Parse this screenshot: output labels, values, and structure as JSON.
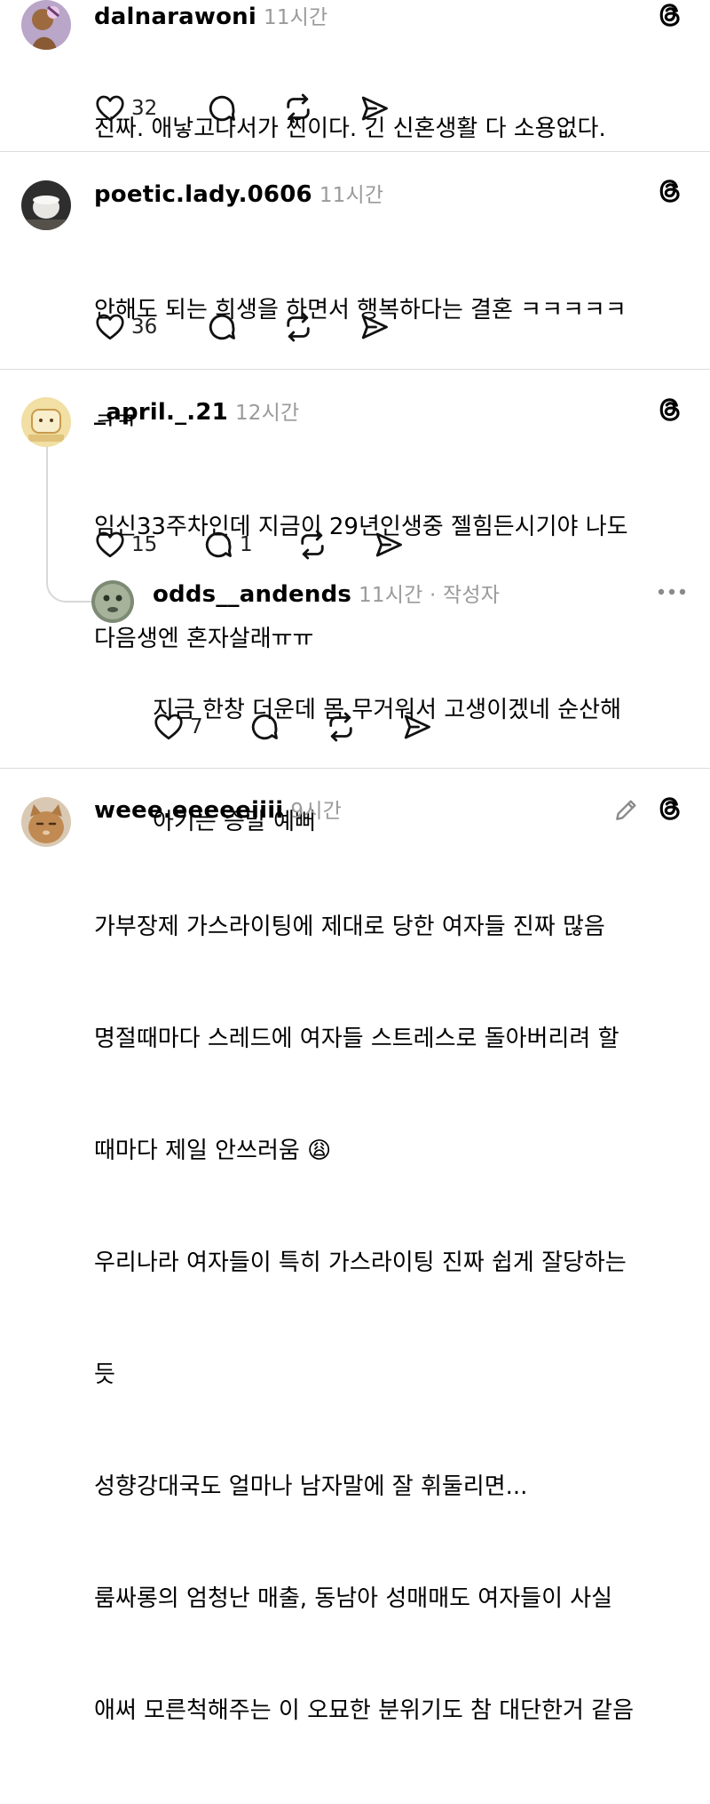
{
  "posts": [
    {
      "username": "dalnarawoni",
      "time": "11시간",
      "lines": [
        "진짜. 애낳고나서가 찐이다. 긴 신혼생활 다 소용없다."
      ],
      "likes": "32",
      "replies": ""
    },
    {
      "username": "poetic.lady.0606",
      "time": "11시간",
      "lines": [
        "안해도 되는 희생을 하면서 행복하다는 결혼 ㅋㅋㅋㅋㅋ",
        "ㅋㅋ"
      ],
      "likes": "36",
      "replies": ""
    },
    {
      "username": "_april._.21",
      "time": "12시간",
      "lines": [
        "임신33주차인데 지금이 29년인생중 젤힘든시기야 나도",
        "다음생엔 혼자살래ㅠㅠ"
      ],
      "likes": "15",
      "replies": "1"
    },
    {
      "username": "odds__andends",
      "time": "11시간",
      "author_tag": " · 작성자",
      "lines": [
        "지금 한창 더운데 몸 무거워서 고생이겠네 순산해",
        "아기는 증말 예뻐"
      ],
      "likes": "7",
      "replies": ""
    },
    {
      "username": "weee.eeeeeiiii",
      "time": "9시간",
      "lines": [
        "가부장제 가스라이팅에 제대로 당한 여자들 진짜 많음",
        "명절때마다 스레드에 여자들 스트레스로 돌아버리려 할",
        "때마다 제일 안쓰러움 😩",
        "우리나라 여자들이 특히 가스라이팅 진짜 쉽게 잘당하는",
        "듯",
        "성향강대국도 얼마나 남자말에 잘 휘둘리면...",
        "룸싸롱의 엄청난 매출, 동남아 성매매도 여자들이 사실",
        "애써 모른척해주는 이 오묘한 분위기도 참 대단한거 같음"
      ]
    }
  ],
  "icons": {
    "like": "heart-icon",
    "reply": "comment-bubble-icon",
    "repost": "repost-arrows-icon",
    "share": "send-icon",
    "app": "threads-logo-icon",
    "more": "more-dots-icon",
    "edit": "pencil-icon"
  },
  "colors": {
    "text": "#000000",
    "muted": "#9a9a9a",
    "divider": "#dcdcdc"
  }
}
